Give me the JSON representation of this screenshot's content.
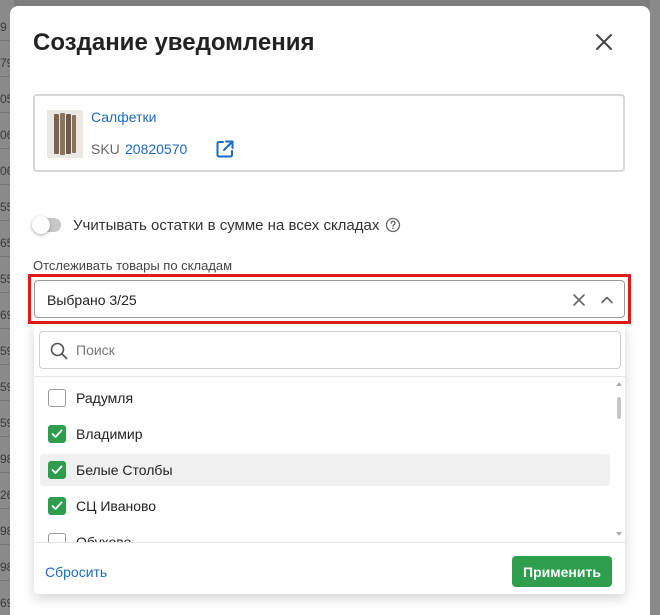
{
  "background": {
    "row_fragments": [
      "9",
      "79",
      "05",
      "06",
      "06",
      "55",
      "65",
      "55",
      "69",
      "59",
      "59",
      "59",
      "98",
      "26",
      "98",
      "98",
      "69"
    ]
  },
  "modal": {
    "title": "Создание уведомления",
    "close_icon": "close-icon"
  },
  "product": {
    "name": "Салфетки",
    "sku_label": "SKU",
    "sku_value": "20820570",
    "link_icon": "external-link-icon"
  },
  "toggle": {
    "label": "Учитывать остатки в сумме на всех складах",
    "state": "off"
  },
  "warehouse_select": {
    "label": "Отслеживать товары по складам",
    "value": "Выбрано 3/25",
    "highlight_color": "#e01b1b"
  },
  "dropdown": {
    "search_placeholder": "Поиск",
    "items": [
      {
        "label": "Радумля",
        "checked": false
      },
      {
        "label": "Владимир",
        "checked": true
      },
      {
        "label": "Белые Столбы",
        "checked": true
      },
      {
        "label": "СЦ Иваново",
        "checked": true
      },
      {
        "label": "Обухово",
        "checked": false
      }
    ],
    "reset_label": "Сбросить",
    "apply_label": "Применить"
  },
  "colors": {
    "accent_green": "#2e9e4e",
    "link_blue": "#1a6ac7"
  }
}
